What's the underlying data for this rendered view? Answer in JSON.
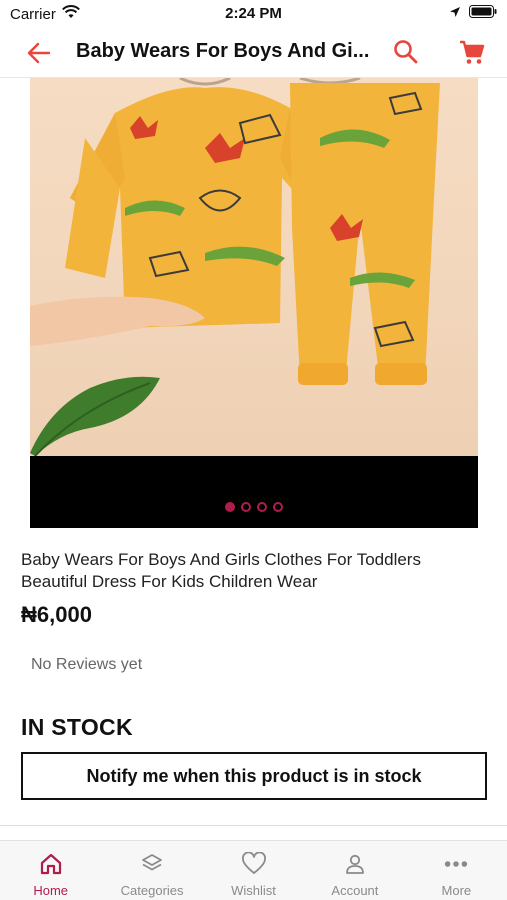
{
  "status_bar": {
    "carrier": "Carrier",
    "time": "2:24 PM"
  },
  "header": {
    "title": "Baby Wears For Boys And Gi..."
  },
  "gallery": {
    "dot_count": 4,
    "active_index": 0
  },
  "product": {
    "name": "Baby Wears For Boys And Girls Clothes For Toddlers Beautiful Dress For Kids Children Wear",
    "price": "₦6,000",
    "reviews": "No Reviews yet",
    "stock_status": "IN STOCK",
    "notify_label": "Notify me when this product is in stock"
  },
  "tabs": [
    {
      "label": "Home",
      "icon": "home-icon",
      "active": true
    },
    {
      "label": "Categories",
      "icon": "layers-icon",
      "active": false
    },
    {
      "label": "Wishlist",
      "icon": "heart-icon",
      "active": false
    },
    {
      "label": "Account",
      "icon": "person-icon",
      "active": false
    },
    {
      "label": "More",
      "icon": "more-icon",
      "active": false
    }
  ],
  "colors": {
    "accent": "#b01d4a",
    "icon_red": "#e8453c",
    "tab_inactive": "#8a8a8a"
  }
}
